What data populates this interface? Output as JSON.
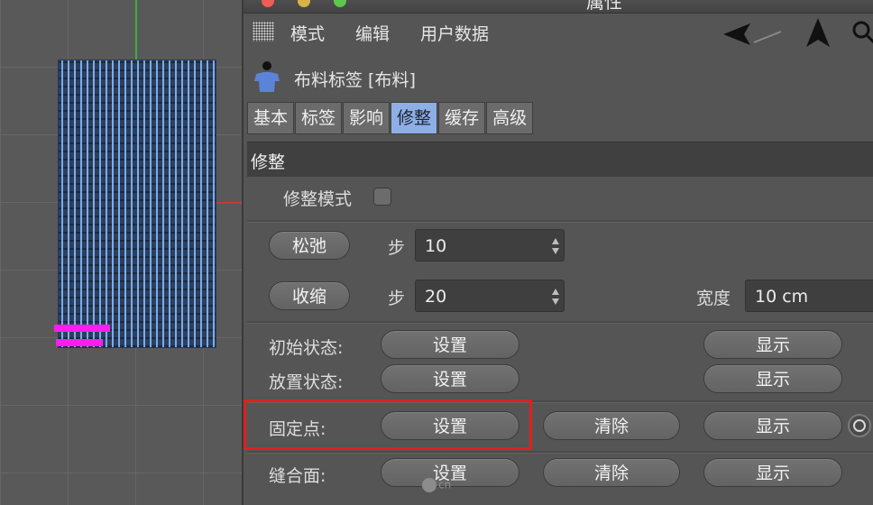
{
  "window": {
    "title": "属性"
  },
  "menu": {
    "items": [
      "模式",
      "编辑",
      "用户数据"
    ]
  },
  "tag": {
    "title": "布料标签 [布料]"
  },
  "tabs": [
    "基本",
    "标签",
    "影响",
    "修整",
    "缓存",
    "高级"
  ],
  "active_tab": "修整",
  "section": {
    "title": "修整",
    "dress_mode_label": "修整模式",
    "relax": {
      "button": "松弛",
      "step_label": "步",
      "step_value": "10"
    },
    "shrink": {
      "button": "收缩",
      "step_label": "步",
      "step_value": "20",
      "width_label": "宽度",
      "width_value": "10 cm"
    },
    "rows": [
      {
        "label": "初始状态:",
        "set": "设置",
        "show": "显示"
      },
      {
        "label": "放置状态:",
        "set": "设置",
        "show": "显示"
      },
      {
        "label": "固定点:",
        "set": "设置",
        "clear": "清除",
        "show": "显示"
      },
      {
        "label": "缝合面:",
        "set": "设置",
        "clear": "清除",
        "show": "显示"
      }
    ]
  },
  "watermark": {
    "text": "cn"
  },
  "colors": {
    "active_tab": "#8eaee6",
    "highlight": "#e02020",
    "cloth": "#2c3f5f",
    "pin": "#ff1cf0",
    "axis_y": "#3cb13c",
    "axis_x": "#c23a3a"
  }
}
